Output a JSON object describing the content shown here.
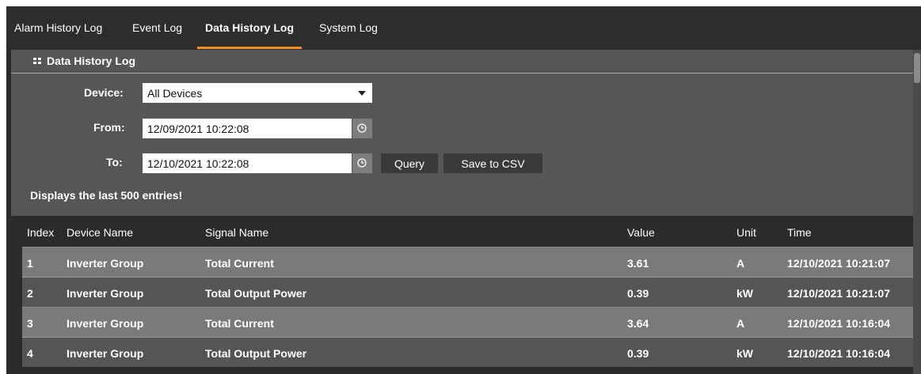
{
  "tabs": [
    {
      "label": "Alarm History Log",
      "active": false
    },
    {
      "label": "Event Log",
      "active": false
    },
    {
      "label": "Data History Log",
      "active": true
    },
    {
      "label": "System Log",
      "active": false
    }
  ],
  "accent_color": "#f0901e",
  "panel": {
    "title": "Data History Log",
    "icon": "grid-icon"
  },
  "form": {
    "device_label": "Device:",
    "device_value": "All Devices",
    "from_label": "From:",
    "from_value": "12/09/2021 10:22:08",
    "to_label": "To:",
    "to_value": "12/10/2021 10:22:08",
    "query_label": "Query",
    "save_label": "Save to CSV",
    "note": "Displays the last 500 entries!"
  },
  "table": {
    "headers": {
      "index": "Index",
      "device": "Device Name",
      "signal": "Signal Name",
      "value": "Value",
      "unit": "Unit",
      "time": "Time"
    },
    "rows": [
      {
        "index": "1",
        "device": "Inverter Group",
        "signal": "Total Current",
        "value": "3.61",
        "unit": "A",
        "time": "12/10/2021 10:21:07"
      },
      {
        "index": "2",
        "device": "Inverter Group",
        "signal": "Total Output Power",
        "value": "0.39",
        "unit": "kW",
        "time": "12/10/2021 10:21:07"
      },
      {
        "index": "3",
        "device": "Inverter Group",
        "signal": "Total Current",
        "value": "3.64",
        "unit": "A",
        "time": "12/10/2021 10:16:04"
      },
      {
        "index": "4",
        "device": "Inverter Group",
        "signal": "Total Output Power",
        "value": "0.39",
        "unit": "kW",
        "time": "12/10/2021 10:16:04"
      }
    ]
  }
}
